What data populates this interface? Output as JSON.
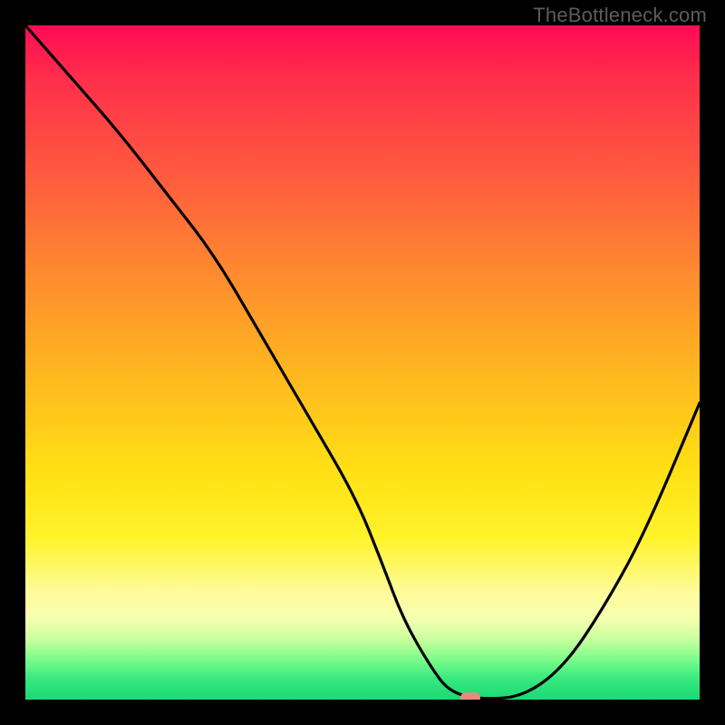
{
  "watermark": "TheBottleneck.com",
  "chart_data": {
    "type": "line",
    "title": "",
    "xlabel": "",
    "ylabel": "",
    "xlim": [
      0,
      100
    ],
    "ylim": [
      0,
      100
    ],
    "grid": false,
    "legend": false,
    "annotations": [],
    "series": [
      {
        "name": "bottleneck-curve",
        "x": [
          0,
          7,
          14,
          21,
          28,
          35,
          42,
          49,
          53,
          56,
          60,
          63,
          68,
          74,
          80,
          86,
          92,
          100
        ],
        "values": [
          100,
          92,
          84,
          75,
          66,
          54,
          42,
          30,
          20,
          12,
          5,
          1,
          0,
          0.5,
          5,
          14,
          25,
          44
        ]
      }
    ],
    "marker": {
      "shape": "rounded-rect",
      "x": 66,
      "y": 0,
      "color": "#e88a7d"
    },
    "background_gradient": {
      "stops": [
        {
          "pos": 0,
          "color": "#ff0b55"
        },
        {
          "pos": 8,
          "color": "#ff2f4a"
        },
        {
          "pos": 22,
          "color": "#ff5a3f"
        },
        {
          "pos": 38,
          "color": "#ff8e2e"
        },
        {
          "pos": 52,
          "color": "#ffb81f"
        },
        {
          "pos": 66,
          "color": "#ffe014"
        },
        {
          "pos": 76,
          "color": "#fff32a"
        },
        {
          "pos": 84,
          "color": "#fffb9a"
        },
        {
          "pos": 88,
          "color": "#f6ffb0"
        },
        {
          "pos": 91,
          "color": "#c9ff9e"
        },
        {
          "pos": 94,
          "color": "#7dfc8b"
        },
        {
          "pos": 97,
          "color": "#35e97e"
        },
        {
          "pos": 100,
          "color": "#1cd876"
        }
      ]
    }
  }
}
